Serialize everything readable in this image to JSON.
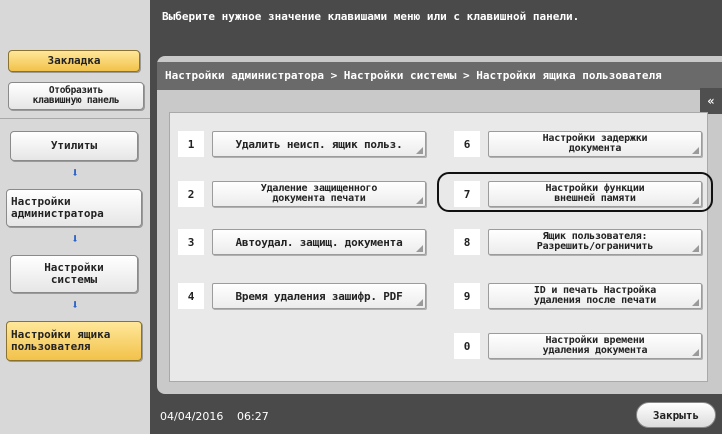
{
  "message": "Выберите нужное значение клавишами меню или с клавишной панели.",
  "sidebar": {
    "bookmark": "Закладка",
    "show_keypad": "Отобразить\nклавишную панель",
    "utilities": "Утилиты",
    "admin_settings": "Настройки\nадминистратора",
    "system_settings": "Настройки\nсистемы",
    "user_box_settings": "Настройки ящика\nпользователя"
  },
  "breadcrumb": "Настройки администратора > Настройки системы > Настройки ящика пользователя",
  "collapse_icon": "«",
  "options": [
    {
      "num": "1",
      "label": "Удалить неисп. ящик польз."
    },
    {
      "num": "2",
      "label": "Удаление защищенного\nдокумента печати"
    },
    {
      "num": "3",
      "label": "Автоудал. защищ. документа"
    },
    {
      "num": "4",
      "label": "Время удаления зашифр. PDF"
    },
    {
      "num": "6",
      "label": "Настройки задержки\nдокумента"
    },
    {
      "num": "7",
      "label": "Настройки функции\nвнешней памяти"
    },
    {
      "num": "8",
      "label": "Ящик пользователя:\nРазрешить/ограничить"
    },
    {
      "num": "9",
      "label": "ID и печать Настройка\nудаления после печати"
    },
    {
      "num": "0",
      "label": "Настройки времени\nудаления документа"
    }
  ],
  "footer": {
    "date": "04/04/2016",
    "time": "06:27",
    "close": "Закрыть"
  }
}
